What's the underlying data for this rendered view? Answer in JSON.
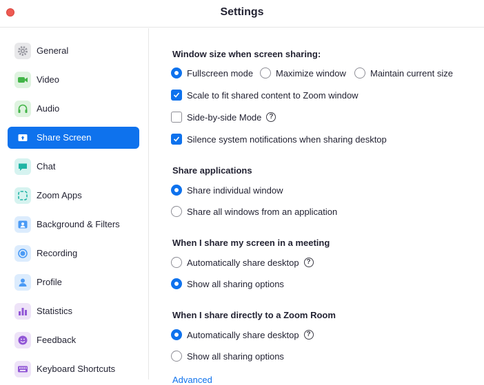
{
  "window": {
    "title": "Settings"
  },
  "sidebar": {
    "items": [
      {
        "label": "General",
        "icon": "gear-icon",
        "color": "#e5e5e8"
      },
      {
        "label": "Video",
        "icon": "video-camera-icon",
        "color": "#dff3e0"
      },
      {
        "label": "Audio",
        "icon": "headphones-icon",
        "color": "#dff3e0"
      },
      {
        "label": "Share Screen",
        "icon": "share-screen-icon",
        "color": "#0e72ed"
      },
      {
        "label": "Chat",
        "icon": "chat-bubble-icon",
        "color": "#d6f3f0"
      },
      {
        "label": "Zoom Apps",
        "icon": "apps-icon",
        "color": "#d6f3f0"
      },
      {
        "label": "Background & Filters",
        "icon": "background-person-icon",
        "color": "#dcecfd"
      },
      {
        "label": "Recording",
        "icon": "record-icon",
        "color": "#dcecfd"
      },
      {
        "label": "Profile",
        "icon": "profile-icon",
        "color": "#dcecfd"
      },
      {
        "label": "Statistics",
        "icon": "bar-chart-icon",
        "color": "#eee3f8"
      },
      {
        "label": "Feedback",
        "icon": "smiley-icon",
        "color": "#eee3f8"
      },
      {
        "label": "Keyboard Shortcuts",
        "icon": "keyboard-icon",
        "color": "#eee3f8"
      }
    ],
    "active": "Share Screen"
  },
  "main": {
    "window_size": {
      "title": "Window size when screen sharing:",
      "options": [
        "Fullscreen mode",
        "Maximize window",
        "Maintain current size"
      ],
      "selected": "Fullscreen mode"
    },
    "checkboxes": [
      {
        "label": "Scale to fit shared content to Zoom window",
        "checked": true
      },
      {
        "label": "Side-by-side Mode",
        "checked": false
      },
      {
        "label": "Silence system notifications when sharing desktop",
        "checked": true
      }
    ],
    "share_apps": {
      "title": "Share applications",
      "options": [
        "Share individual window",
        "Share all windows from an application"
      ],
      "selected": "Share individual window"
    },
    "meeting": {
      "title": "When I share my screen in a meeting",
      "options": [
        "Automatically share desktop",
        "Show all sharing options"
      ],
      "selected": "Show all sharing options"
    },
    "zoom_room": {
      "title": "When I share directly to a Zoom Room",
      "options": [
        "Automatically share desktop",
        "Show all sharing options"
      ],
      "selected": "Automatically share desktop"
    },
    "help_glyph": "?",
    "advanced_label": "Advanced"
  },
  "colors": {
    "accent": "#0e72ed",
    "close": "#ee5a52"
  }
}
